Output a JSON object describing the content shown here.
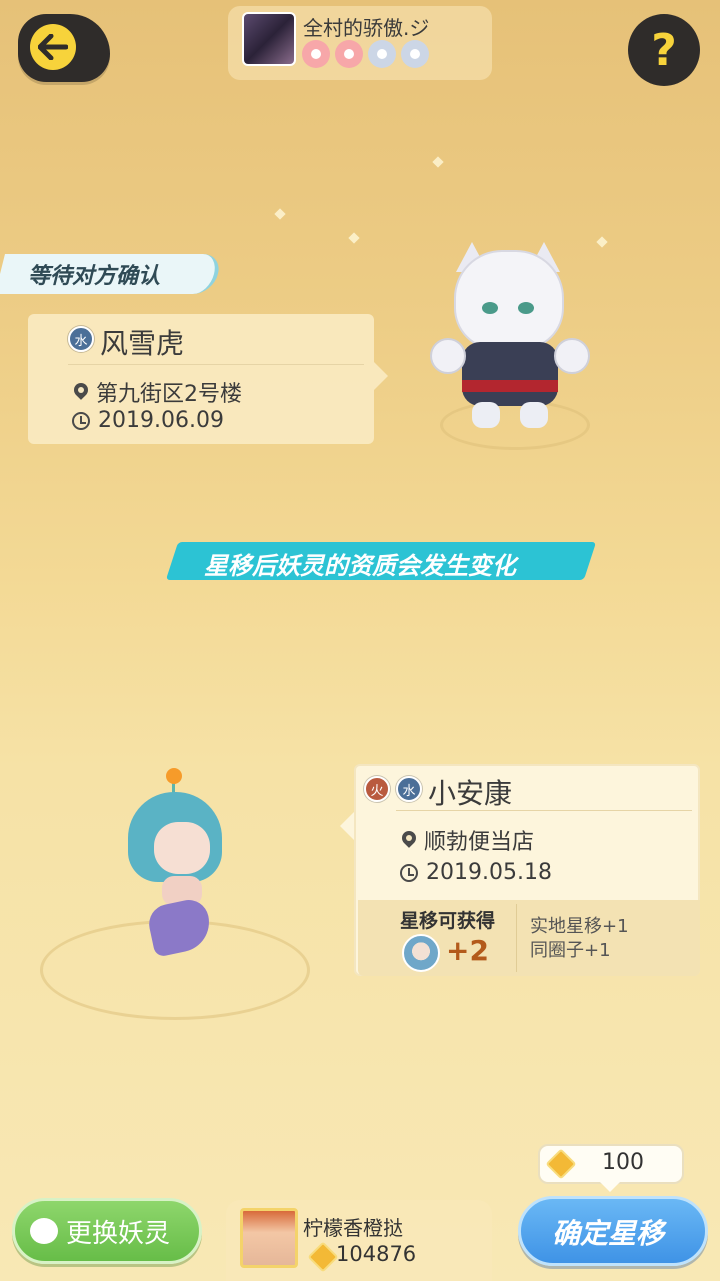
{
  "header": {
    "back_icon": "back-arrow-icon",
    "help_icon": "question-mark-icon",
    "help_label": "?",
    "opponent": {
      "name": "全村的骄傲.ジ",
      "flowers_total": 4,
      "flowers_lit": 2
    }
  },
  "status_banner": "等待对方确认",
  "opponent_pet": {
    "elements": [
      "水"
    ],
    "name": "风雪虎",
    "location": "第九街区2号楼",
    "date": "2019.06.09"
  },
  "notice_banner": "星移后妖灵的资质会发生变化",
  "my_pet": {
    "elements": [
      "火",
      "水"
    ],
    "name": "小安康",
    "location": "顺勃便当店",
    "date": "2019.05.18",
    "reward": {
      "title": "星移可获得",
      "amount": "+2",
      "bonuses": [
        "实地星移+1",
        "同圈子+1"
      ]
    }
  },
  "bottom": {
    "change_button": "更换妖灵",
    "user": {
      "name": "柠檬香橙挞",
      "coins": "104876"
    },
    "cost": "100",
    "confirm_button": "确定星移"
  },
  "colors": {
    "accent_yellow": "#f7d33b",
    "confirm_blue": "#3f93e6",
    "change_green": "#67bd48",
    "banner_cyan": "#2cc3d4"
  }
}
